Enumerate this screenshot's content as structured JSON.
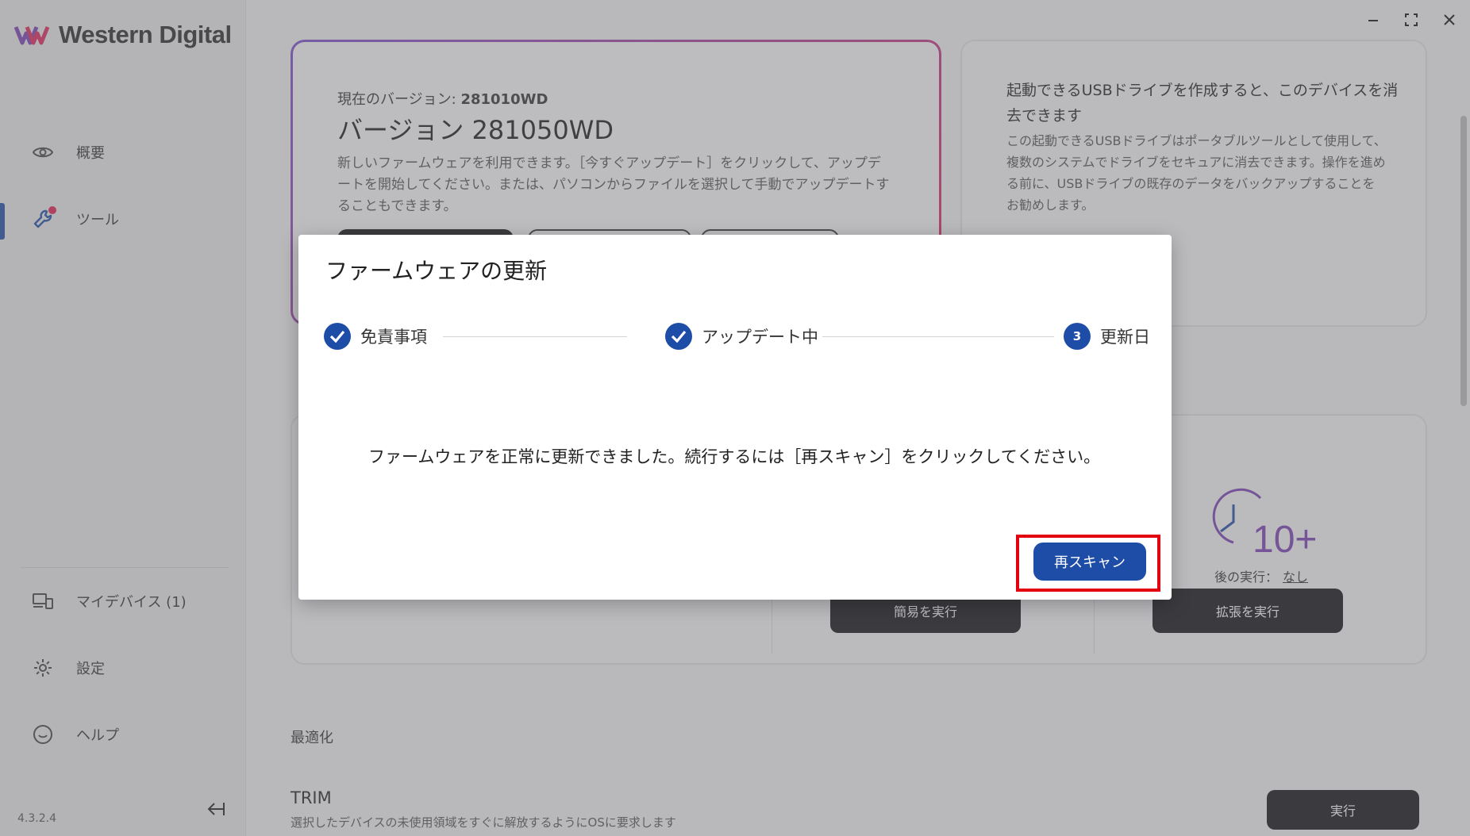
{
  "app": {
    "brand": "Western Digital",
    "version": "4.3.2.4",
    "accent_color": "#1e4da8",
    "highlight_color": "#e3000f"
  },
  "window": {
    "minimize_icon": "minimize-icon",
    "maximize_icon": "maximize-icon",
    "close_icon": "close-icon"
  },
  "sidebar": {
    "items": [
      {
        "label": "概要",
        "icon": "eye-icon"
      },
      {
        "label": "ツール",
        "icon": "wrench-icon",
        "active": true,
        "badge": true
      },
      {
        "label": "マイデバイス (1)",
        "icon": "devices-icon"
      },
      {
        "label": "設定",
        "icon": "gear-icon"
      },
      {
        "label": "ヘルプ",
        "icon": "help-icon"
      }
    ]
  },
  "firmware_card": {
    "current_label": "現在のバージョン:",
    "current_value": "281010WD",
    "new_version": "バージョン 281050WD",
    "description": "新しいファームウェアを利用できます。［今すぐアップデート］をクリックして、アップデートを開始してください。または、パソコンからファイルを選択して手動でアップデートすることもできます。"
  },
  "usb_card": {
    "title": "起動できるUSBドライブを作成すると、このデバイスを消去できます",
    "description": "この起動できるUSBドライブはポータブルツールとして使用して、複数のシステムでドライブをセキュアに消去できます。操作を進める前に、USBドライブの既存のデータをバックアップすることをお勧めします。"
  },
  "diagnostics": {
    "clock_label": "10+",
    "last_run_label": "後の実行：",
    "last_run_value": "なし",
    "quick_button": "簡易を実行",
    "extended_button": "拡張を実行"
  },
  "optimize": {
    "section_title": "最適化",
    "trim_title": "TRIM",
    "trim_desc": "選択したデバイスの未使用領域をすぐに解放するようにOSに要求します",
    "run_button": "実行"
  },
  "modal": {
    "title": "ファームウェアの更新",
    "steps": [
      {
        "label": "免責事項",
        "state": "done"
      },
      {
        "label": "アップデート中",
        "state": "done"
      },
      {
        "label": "更新日",
        "state": "current",
        "number": "3"
      }
    ],
    "message": "ファームウェアを正常に更新できました。続行するには［再スキャン］をクリックしてください。",
    "rescan_button": "再スキャン"
  }
}
